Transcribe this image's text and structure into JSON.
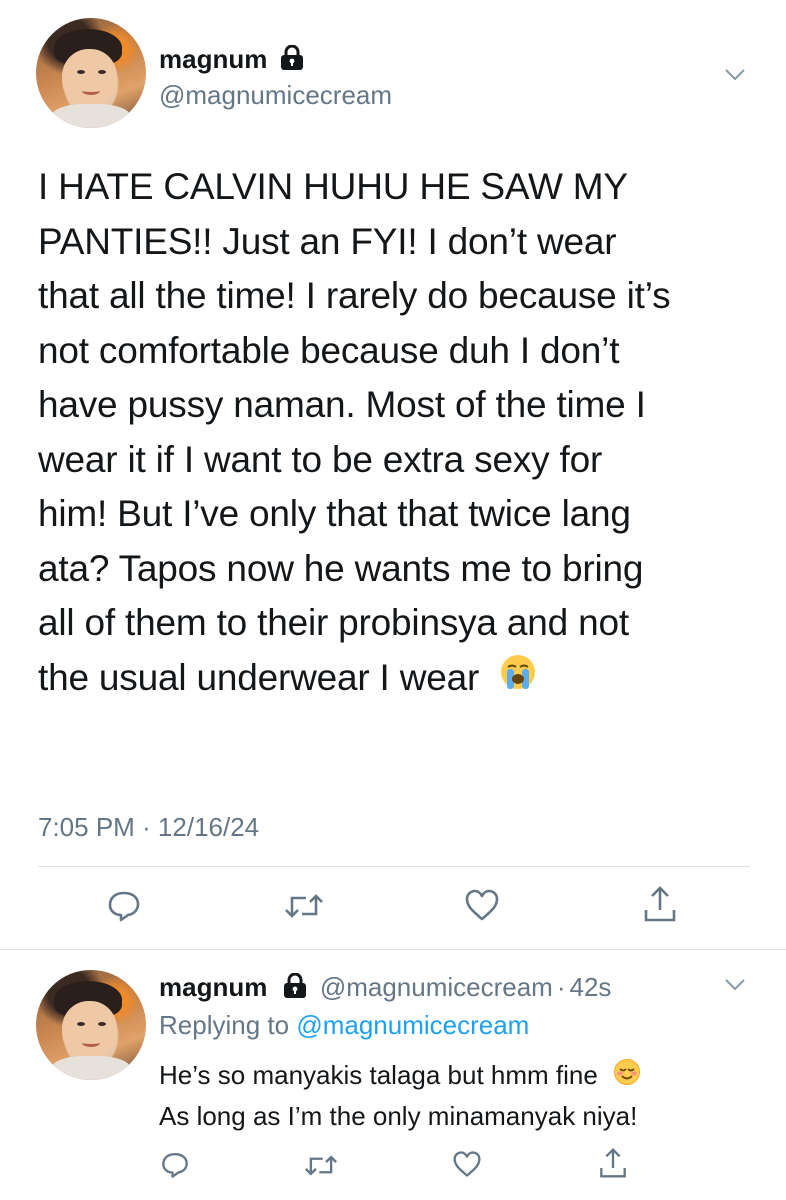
{
  "main_tweet": {
    "display_name": "magnum",
    "handle": "@magnumicecream",
    "text": "I HATE CALVIN HUHU HE SAW MY PANTIES!! Just an FYI! I don’t wear that all the time! I rarely do because it’s not comfortable because duh I don’t have pussy naman. Most of the time I wear it if I want to be extra sexy for him! But I’ve only that that twice lang ata? Tapos now he wants me to bring all of them to their probinsya and not the usual underwear I wear",
    "text_lines": [
      "I HATE CALVIN HUHU HE SAW MY",
      "PANTIES!! Just an FYI! I don’t wear",
      "that all the time! I rarely do because it’s",
      "not comfortable because duh I don’t",
      "have pussy naman. Most of the time I",
      "wear it if I want to be extra sexy for",
      "him! But I’ve only that that twice lang",
      "ata? Tapos now he wants me to bring",
      "all of them to their probinsya and not",
      "the usual underwear I wear"
    ],
    "emoji": "loudly-crying-face",
    "timestamp": "7:05 PM · 12/16/24",
    "actions": [
      "reply-icon",
      "retweet-icon",
      "like-icon",
      "share-icon"
    ]
  },
  "reply_tweet": {
    "display_name": "magnum",
    "handle": "@magnumicecream",
    "separator": "·",
    "time_ago": "42s",
    "replying_to_prefix": "Replying to",
    "replying_to_handle": "@magnumicecream",
    "text_lines": [
      "He’s so manyakis talaga but hmm fine",
      "As long as I’m the only minamanyak niya!"
    ],
    "emoji": "smiling-face",
    "actions": [
      "reply-icon",
      "retweet-icon",
      "like-icon",
      "share-icon"
    ]
  },
  "colors": {
    "text": "#14171a",
    "secondary": "#657786",
    "link": "#1da1f2",
    "divider": "#dfe3e6"
  }
}
